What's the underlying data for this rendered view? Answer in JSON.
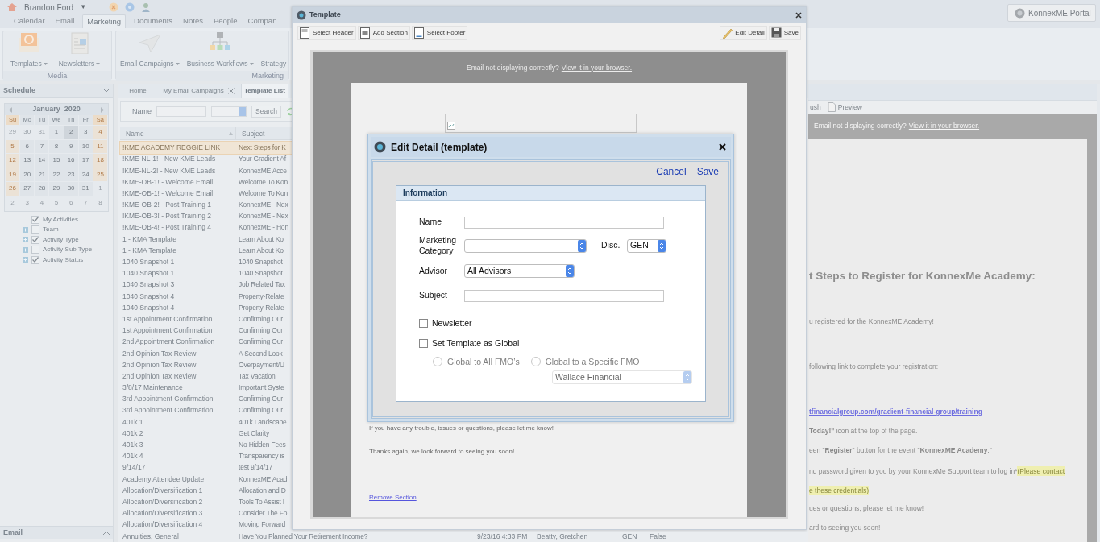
{
  "topbar": {
    "user": "Brandon Ford",
    "user_caret": "▼",
    "portal_button": "KonnexME Portal"
  },
  "nav_tabs": [
    {
      "label": "Calendar",
      "selected": false
    },
    {
      "label": "Email",
      "selected": false
    },
    {
      "label": "Marketing",
      "selected": true
    },
    {
      "label": "Documents",
      "selected": false
    },
    {
      "label": "Notes",
      "selected": false
    },
    {
      "label": "People",
      "selected": false
    },
    {
      "label": "Compan",
      "selected": false
    }
  ],
  "ribbon": [
    {
      "label": "Media",
      "items": [
        {
          "label": "Templates",
          "menu": true
        },
        {
          "label": "Newsletters",
          "menu": true
        }
      ]
    },
    {
      "label": "Marketing",
      "items": [
        {
          "label": "Email Campaigns",
          "menu": true
        },
        {
          "label": "Business Workflows",
          "menu": true
        },
        {
          "label": "Strategy",
          "menu": false
        }
      ]
    }
  ],
  "schedule": {
    "title": "Schedule",
    "month": "January  2020",
    "weekdays": [
      "Su",
      "Mo",
      "Tu",
      "We",
      "Th",
      "Fr",
      "Sa"
    ],
    "days": [
      {
        "label": "29",
        "in_month": false,
        "selected": false
      },
      {
        "label": "30",
        "in_month": false,
        "selected": false
      },
      {
        "label": "31",
        "in_month": false,
        "selected": false
      },
      {
        "label": "1",
        "in_month": true,
        "selected": false
      },
      {
        "label": "2",
        "in_month": true,
        "selected": true
      },
      {
        "label": "3",
        "in_month": true,
        "selected": false
      },
      {
        "label": "4",
        "in_month": true,
        "selected": false
      },
      {
        "label": "5",
        "in_month": true,
        "selected": false
      },
      {
        "label": "6",
        "in_month": true,
        "selected": false
      },
      {
        "label": "7",
        "in_month": true,
        "selected": false
      },
      {
        "label": "8",
        "in_month": true,
        "selected": false
      },
      {
        "label": "9",
        "in_month": true,
        "selected": false
      },
      {
        "label": "10",
        "in_month": true,
        "selected": false
      },
      {
        "label": "11",
        "in_month": true,
        "selected": false
      },
      {
        "label": "12",
        "in_month": true,
        "selected": false
      },
      {
        "label": "13",
        "in_month": true,
        "selected": false
      },
      {
        "label": "14",
        "in_month": true,
        "selected": false
      },
      {
        "label": "15",
        "in_month": true,
        "selected": false
      },
      {
        "label": "16",
        "in_month": true,
        "selected": false
      },
      {
        "label": "17",
        "in_month": true,
        "selected": false
      },
      {
        "label": "18",
        "in_month": true,
        "selected": false
      },
      {
        "label": "19",
        "in_month": true,
        "selected": false
      },
      {
        "label": "20",
        "in_month": true,
        "selected": false
      },
      {
        "label": "21",
        "in_month": true,
        "selected": false
      },
      {
        "label": "22",
        "in_month": true,
        "selected": false
      },
      {
        "label": "23",
        "in_month": true,
        "selected": false
      },
      {
        "label": "24",
        "in_month": true,
        "selected": false
      },
      {
        "label": "25",
        "in_month": true,
        "selected": false
      },
      {
        "label": "26",
        "in_month": true,
        "selected": false
      },
      {
        "label": "27",
        "in_month": true,
        "selected": false
      },
      {
        "label": "28",
        "in_month": true,
        "selected": false
      },
      {
        "label": "29",
        "in_month": true,
        "selected": false
      },
      {
        "label": "30",
        "in_month": true,
        "selected": false
      },
      {
        "label": "31",
        "in_month": true,
        "selected": false
      },
      {
        "label": "1",
        "in_month": false,
        "selected": false
      },
      {
        "label": "2",
        "in_month": false,
        "selected": false
      },
      {
        "label": "3",
        "in_month": false,
        "selected": false
      },
      {
        "label": "4",
        "in_month": false,
        "selected": false
      },
      {
        "label": "5",
        "in_month": false,
        "selected": false
      },
      {
        "label": "6",
        "in_month": false,
        "selected": false
      },
      {
        "label": "7",
        "in_month": false,
        "selected": false
      },
      {
        "label": "8",
        "in_month": false,
        "selected": false
      }
    ],
    "filters": [
      {
        "label": "My Activities",
        "checked": true,
        "expandable": false
      },
      {
        "label": "Team",
        "checked": false,
        "expandable": true
      },
      {
        "label": "Activity Type",
        "checked": true,
        "expandable": true
      },
      {
        "label": "Activity Sub Type",
        "checked": false,
        "expandable": true
      },
      {
        "label": "Activity Status",
        "checked": true,
        "expandable": true
      }
    ]
  },
  "email_section": {
    "title": "Email"
  },
  "list_tabs": [
    {
      "label": "Home",
      "selected": false,
      "closable": false
    },
    {
      "label": "My Email Campaigns",
      "selected": false,
      "closable": true
    },
    {
      "label": "Template List",
      "selected": true,
      "closable": false
    }
  ],
  "search": {
    "label": "Name",
    "button": "Search"
  },
  "table": {
    "columns": [
      "Name",
      "Subject"
    ],
    "rows": [
      {
        "cells": [
          "!KME ACADEMY REGGIE LINK",
          "Next Steps for K"
        ],
        "selected": true
      },
      {
        "cells": [
          "!KME-NL-1! - New KME Leads",
          "Your Gradient Af"
        ],
        "selected": false
      },
      {
        "cells": [
          "!KME-NL-2! - New KME Leads",
          "KonnexME Acce"
        ],
        "selected": false
      },
      {
        "cells": [
          "!KME-OB-1! - Welcome Email",
          "Welcome To Kon"
        ],
        "selected": false
      },
      {
        "cells": [
          "!KME-OB-1! - Welcome Email",
          "Welcome To Kon"
        ],
        "selected": false
      },
      {
        "cells": [
          "!KME-OB-2! - Post Training 1",
          "KonnexME - Nex"
        ],
        "selected": false
      },
      {
        "cells": [
          "!KME-OB-3! - Post Training 2",
          "KonnexME - Nex"
        ],
        "selected": false
      },
      {
        "cells": [
          "!KME-OB-4! - Post Training 4",
          "KonnexME - Hon"
        ],
        "selected": false
      },
      {
        "cells": [
          "1 - KMA Template",
          "Learn About Ko"
        ],
        "selected": false
      },
      {
        "cells": [
          "1 - KMA Template",
          "Learn About Ko"
        ],
        "selected": false
      },
      {
        "cells": [
          "1040 Snapshot 1",
          "1040 Snapshot"
        ],
        "selected": false
      },
      {
        "cells": [
          "1040 Snapshot 1",
          "1040 Snapshot"
        ],
        "selected": false
      },
      {
        "cells": [
          "1040 Snapshot 3",
          "Job Related Tax"
        ],
        "selected": false
      },
      {
        "cells": [
          "1040 Snapshot 4",
          "Property-Relate"
        ],
        "selected": false
      },
      {
        "cells": [
          "1040 Snapshot 4",
          "Property-Relate"
        ],
        "selected": false
      },
      {
        "cells": [
          "1st Appointment Confirmation",
          "Confirming Our"
        ],
        "selected": false
      },
      {
        "cells": [
          "1st Appointment Confirmation",
          "Confirming Our"
        ],
        "selected": false
      },
      {
        "cells": [
          "2nd Appointment Confirmation",
          "Confirming Our"
        ],
        "selected": false
      },
      {
        "cells": [
          "2nd Opinion Tax Review",
          "A Second Look"
        ],
        "selected": false
      },
      {
        "cells": [
          "2nd Opinion Tax Review",
          "Overpayment/U"
        ],
        "selected": false
      },
      {
        "cells": [
          "2nd Opinion Tax Review",
          "Tax Vacation"
        ],
        "selected": false
      },
      {
        "cells": [
          "3/8/17 Maintenance",
          "Important Syste"
        ],
        "selected": false
      },
      {
        "cells": [
          "3rd Appointment Confirmation",
          "Confirming Our"
        ],
        "selected": false
      },
      {
        "cells": [
          "3rd Appointment Confirmation",
          "Confirming Our"
        ],
        "selected": false
      },
      {
        "cells": [
          "401k 1",
          "401k Landscape"
        ],
        "selected": false
      },
      {
        "cells": [
          "401k 2",
          "Get Clarity"
        ],
        "selected": false
      },
      {
        "cells": [
          "401k 3",
          "No Hidden Fees"
        ],
        "selected": false
      },
      {
        "cells": [
          "401k 4",
          "Transparency is"
        ],
        "selected": false
      },
      {
        "cells": [
          "9/14/17",
          "test 9/14/17"
        ],
        "selected": false
      },
      {
        "cells": [
          "Academy Attendee Update",
          "KonnexME Acad"
        ],
        "selected": false
      },
      {
        "cells": [
          "Allocation/Diversification 1",
          "Allocation and D"
        ],
        "selected": false
      },
      {
        "cells": [
          "Allocation/Diversification 2",
          "Tools To Assist I"
        ],
        "selected": false
      },
      {
        "cells": [
          "Allocation/Diversification 3",
          "Consider The Fo"
        ],
        "selected": false
      },
      {
        "cells": [
          "Allocation/Diversification 4",
          "Moving Forward"
        ],
        "selected": false
      },
      {
        "cells": [
          "Annuities, General",
          "Have You Planned Your Retirement Income?",
          "9/23/16 4:33 PM",
          "Beatty, Gretchen",
          "GEN",
          "False"
        ],
        "selected": false
      }
    ]
  },
  "preview": {
    "toolbar": [
      {
        "label": "ush",
        "icon": false
      },
      {
        "label": "Preview",
        "icon": true
      }
    ],
    "notice": "Email not displaying correctly?",
    "notice_link": "View it in your browser.",
    "heading": "t Steps to Register for KonnexMe Academy:",
    "paragraphs": [
      {
        "kind": "text",
        "text": "u registered for the KonnexME Academy!"
      },
      {
        "kind": "text",
        "text": "following link to complete your registration:"
      },
      {
        "kind": "link",
        "text": "tfinancialgroup.com/gradient-financial-group/training"
      },
      {
        "kind": "text",
        "text": "**Today!\"** icon at the top of the page."
      },
      {
        "kind": "text",
        "text": "een \"**Register**\" button for the event \"**KonnexME Academy**.\""
      },
      {
        "kind": "highlight",
        "text": "nd password given to you by your KonnexMe Support team to log in*",
        "highlight": "(Please contact"
      },
      {
        "kind": "highlight",
        "highlight": "e these credentials)"
      },
      {
        "kind": "text",
        "text": "ues or questions, please let me know!"
      },
      {
        "kind": "text",
        "text": "ard to seeing you soon!"
      }
    ]
  },
  "template_window": {
    "title": "Template",
    "toolbar_left": [
      {
        "label": "Select Header"
      },
      {
        "label": "Add Section"
      },
      {
        "label": "Select Footer"
      }
    ],
    "toolbar_right": [
      {
        "label": "Edit Detail"
      },
      {
        "label": "Save"
      }
    ],
    "notice": "Email not displaying correctly?",
    "notice_link": "View it in your browser.",
    "lines": [
      "If you have any trouble, issues or questions, please let me know!",
      "Thanks again, we look forward to seeing you soon!"
    ],
    "remove_link": "Remove Section"
  },
  "dialog": {
    "title": "Edit Detail (template)",
    "cancel": "Cancel",
    "save": "Save",
    "section_title": "Information",
    "name": {
      "label": "Name"
    },
    "marketing_category": {
      "label": "Marketing Category"
    },
    "disc": {
      "label": "Disc.",
      "value": "GEN"
    },
    "advisor": {
      "label": "Advisor",
      "value": "All Advisors"
    },
    "subject": {
      "label": "Subject"
    },
    "checkboxes": [
      {
        "label": "Newsletter",
        "checked": false
      },
      {
        "label": "Set Template as Global",
        "checked": false
      }
    ],
    "radios": [
      {
        "label": "Global to All FMO’s",
        "selected": false,
        "disabled": true
      },
      {
        "label": "Global to a Specific FMO",
        "selected": false,
        "disabled": true
      }
    ],
    "fmo_select": {
      "value": "Wallace Financial",
      "disabled": true
    }
  }
}
